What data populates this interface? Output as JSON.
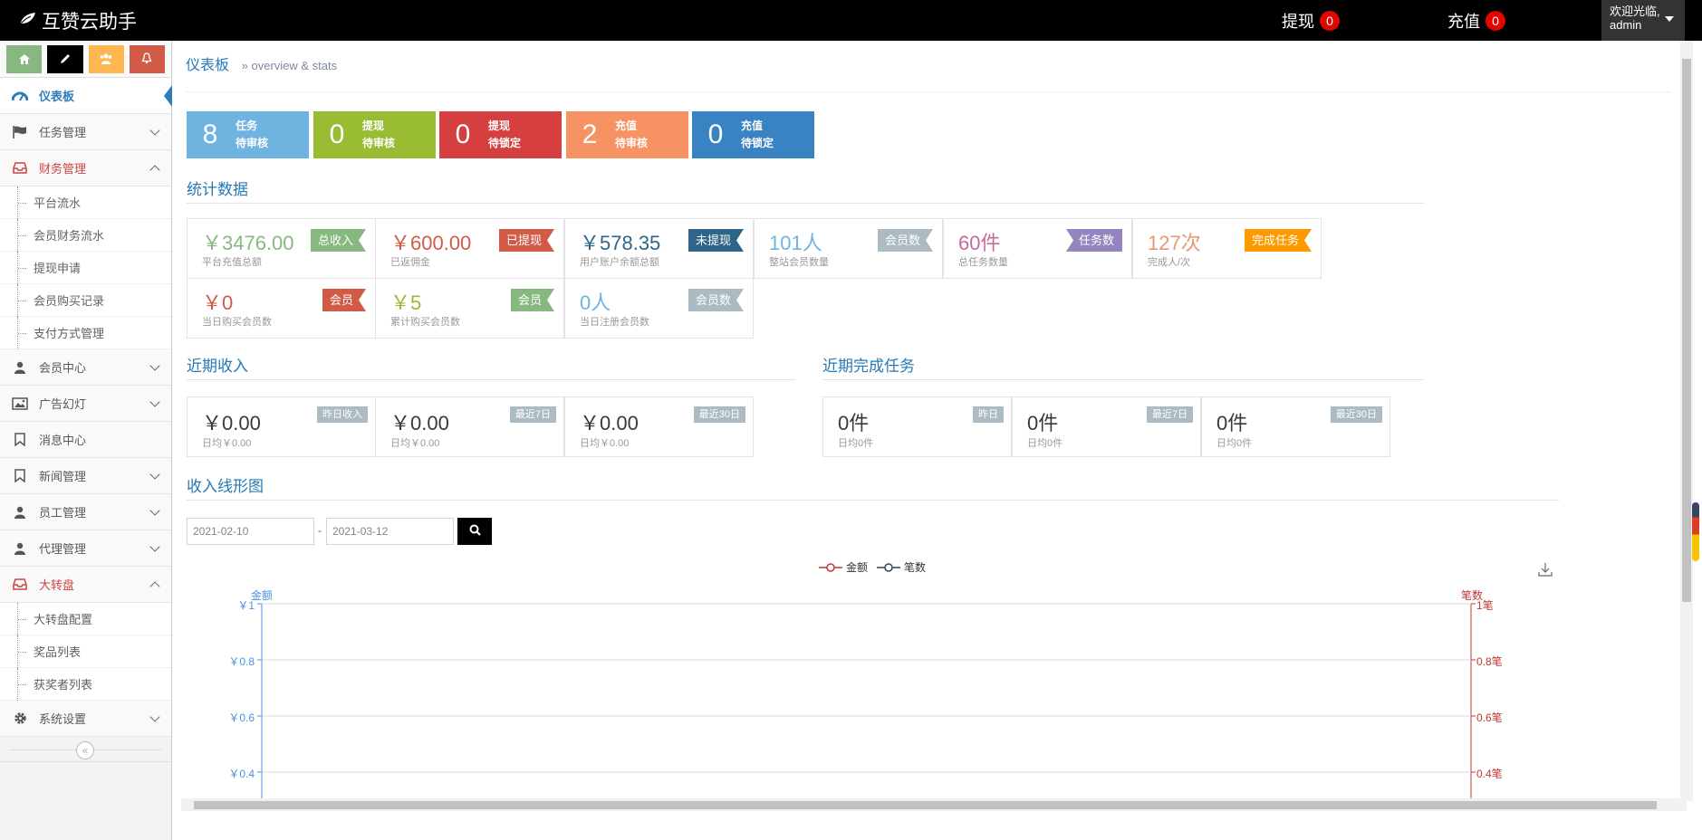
{
  "app": {
    "title": "互赞云助手"
  },
  "topbar": {
    "withdraw_label": "提现",
    "withdraw_count": "0",
    "recharge_label": "充值",
    "recharge_count": "0",
    "welcome": "欢迎光临,",
    "user": "admin"
  },
  "shortcuts": [
    {
      "icon": "home-icon",
      "color": "#87b87f"
    },
    {
      "icon": "pencil-icon",
      "color": "#000000"
    },
    {
      "icon": "users-icon",
      "color": "#ffb752"
    },
    {
      "icon": "bell-icon",
      "color": "#d15b47"
    }
  ],
  "sidebar": {
    "items": [
      {
        "label": "仪表板",
        "icon": "dashboard-icon"
      },
      {
        "label": "任务管理",
        "icon": "flag-icon"
      },
      {
        "label": "财务管理",
        "icon": "inbox-icon"
      },
      {
        "label": "会员中心",
        "icon": "user-icon"
      },
      {
        "label": "广告幻灯",
        "icon": "picture-icon"
      },
      {
        "label": "消息中心",
        "icon": "bookmark-icon"
      },
      {
        "label": "新闻管理",
        "icon": "bookmark-icon"
      },
      {
        "label": "员工管理",
        "icon": "user-icon"
      },
      {
        "label": "代理管理",
        "icon": "user-icon"
      },
      {
        "label": "大转盘",
        "icon": "inbox-icon"
      },
      {
        "label": "系统设置",
        "icon": "gear-icon"
      }
    ],
    "finance_sub": [
      "平台流水",
      "会员财务流水",
      "提现申请",
      "会员购买记录",
      "支付方式管理"
    ],
    "wheel_sub": [
      "大转盘配置",
      "奖品列表",
      "获奖者列表"
    ]
  },
  "header": {
    "title": "仪表板",
    "subtitle": "» overview & stats"
  },
  "infoboxes": [
    {
      "num": "8",
      "l1": "任务",
      "l2": "待审核",
      "color": "#6fb3e0"
    },
    {
      "num": "0",
      "l1": "提现",
      "l2": "待审核",
      "color": "#9abc32"
    },
    {
      "num": "0",
      "l1": "提现",
      "l2": "待锁定",
      "color": "#d53f40"
    },
    {
      "num": "2",
      "l1": "充值",
      "l2": "待审核",
      "color": "#f79263"
    },
    {
      "num": "0",
      "l1": "充值",
      "l2": "待锁定",
      "color": "#3983c2"
    }
  ],
  "sections": {
    "stats": "统计数据",
    "income": "近期收入",
    "tasks": "近期完成任务",
    "chart": "收入线形图"
  },
  "stats": [
    {
      "value": "￥3476.00",
      "desc": "平台充值总额",
      "tag": "总收入",
      "color": "#87b87f",
      "tag_color": "#87b87f"
    },
    {
      "value": "￥600.00",
      "desc": "已返佣金",
      "tag": "已提现",
      "color": "#d15b47",
      "tag_color": "#d15b47"
    },
    {
      "value": "￥578.35",
      "desc": "用户账户余额总额",
      "tag": "未提现",
      "color": "#2e6589",
      "tag_color": "#2e6589"
    },
    {
      "value": "101人",
      "desc": "整站会员数量",
      "tag": "会员数",
      "color": "#6fb3e0",
      "tag_color": "#abbac3"
    },
    {
      "value": "60件",
      "desc": "总任务数量",
      "tag": "任务数",
      "color": "#c6699f",
      "tag_color": "#9585bf"
    },
    {
      "value": "127次",
      "desc": "完成人/次",
      "tag": "完成任务",
      "color": "#e59a6f",
      "tag_color": "#ff9900"
    },
    {
      "value": "￥0",
      "desc": "当日购买会员数",
      "tag": "会员",
      "color": "#d15b47",
      "tag_color": "#d15b47"
    },
    {
      "value": "￥5",
      "desc": "累计购买会员数",
      "tag": "会员",
      "color": "#9abc32",
      "tag_color": "#87b87f"
    },
    {
      "value": "0人",
      "desc": "当日注册会员数",
      "tag": "会员数",
      "color": "#6fb3e0",
      "tag_color": "#abbac3"
    }
  ],
  "income": [
    {
      "value": "￥0.00",
      "desc": "日均￥0.00",
      "tag": "昨日收入"
    },
    {
      "value": "￥0.00",
      "desc": "日均￥0.00",
      "tag": "最近7日"
    },
    {
      "value": "￥0.00",
      "desc": "日均￥0.00",
      "tag": "最近30日"
    }
  ],
  "tasks": [
    {
      "value": "0件",
      "desc": "日均0件",
      "tag": "昨日"
    },
    {
      "value": "0件",
      "desc": "日均0件",
      "tag": "最近7日"
    },
    {
      "value": "0件",
      "desc": "日均0件",
      "tag": "最近30日"
    }
  ],
  "filter": {
    "start": "2021-02-10",
    "sep": "-",
    "end": "2021-03-12"
  },
  "chart_data": {
    "type": "line",
    "series": [
      {
        "name": "金额",
        "values": [],
        "color": "#c23531"
      },
      {
        "name": "笔数",
        "values": [],
        "color": "#2f4554"
      }
    ],
    "ylabel_left": "金额",
    "ylabel_right": "笔数",
    "left_ticks": [
      "￥1",
      "￥0.8",
      "￥0.6",
      "￥0.4"
    ],
    "right_ticks": [
      "1笔",
      "0.8笔",
      "0.6笔",
      "0.4笔"
    ],
    "ylim": [
      0,
      1
    ],
    "grid": true,
    "legend": "top-center"
  }
}
